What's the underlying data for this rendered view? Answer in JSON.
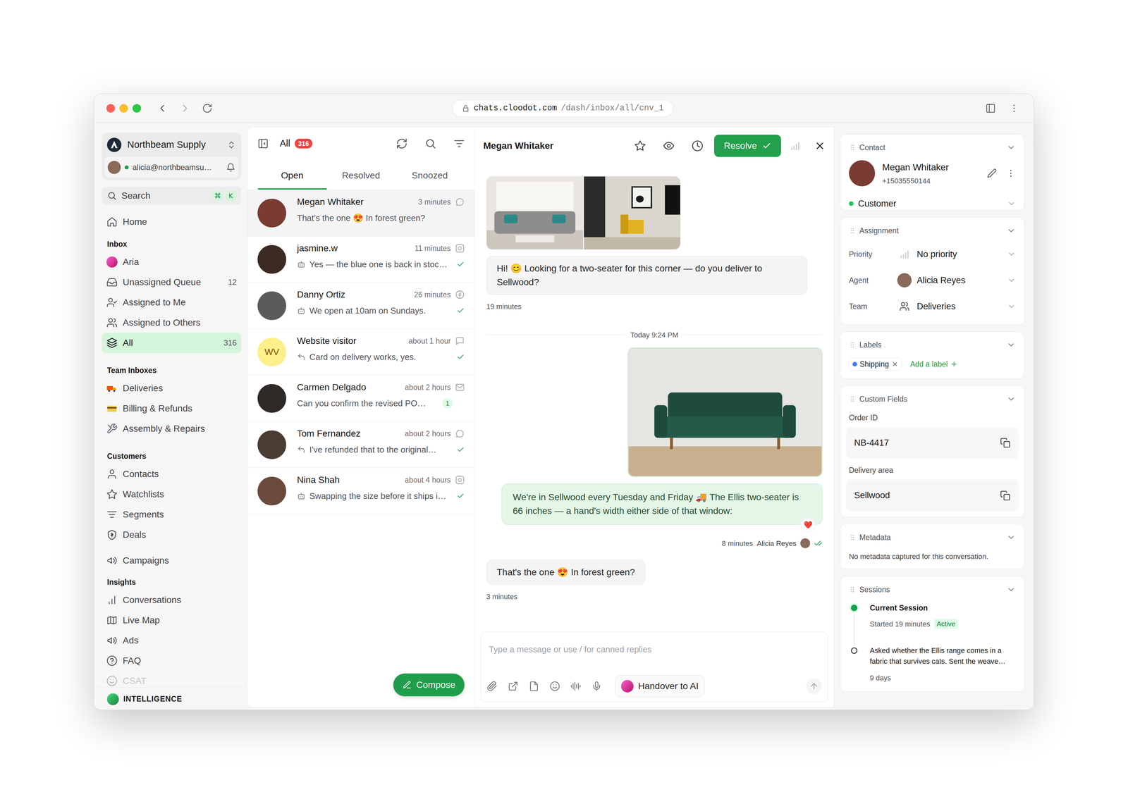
{
  "browser": {
    "host": "chats.cloodot.com",
    "path": "/dash/inbox/all/cnv_1"
  },
  "workspace": {
    "name": "Northbeam Supply",
    "email": "alicia@northbeamsu…",
    "online": true
  },
  "search": {
    "label": "Search",
    "keys": [
      "⌘",
      "K"
    ]
  },
  "nav": {
    "home": {
      "label": "Home",
      "selected": false
    },
    "sections": [
      {
        "title": "Inbox",
        "items": [
          {
            "label": "Aria",
            "kind": "avatar",
            "selected": false
          },
          {
            "label": "Unassigned Queue",
            "kind": "icon",
            "count": "12",
            "selected": false
          },
          {
            "label": "Assigned to Me",
            "kind": "icon",
            "selected": false
          },
          {
            "label": "Assigned to Others",
            "kind": "icon",
            "selected": false
          },
          {
            "label": "All",
            "kind": "icon",
            "count": "316",
            "selected": true
          }
        ]
      },
      {
        "title": "Team Inboxes",
        "items": [
          {
            "label": "Deliveries",
            "selected": false
          },
          {
            "label": "Billing & Refunds",
            "selected": false
          },
          {
            "label": "Assembly & Repairs",
            "selected": false
          }
        ]
      },
      {
        "title": "Customers",
        "items": [
          {
            "label": "Contacts",
            "selected": false
          },
          {
            "label": "Watchlists",
            "selected": false
          },
          {
            "label": "Segments",
            "selected": false
          },
          {
            "label": "Deals",
            "selected": false
          }
        ]
      },
      {
        "title": "Insights",
        "items": [
          {
            "label": "Conversations",
            "selected": false,
            "faded": false
          },
          {
            "label": "Live Map",
            "selected": false,
            "faded": false
          },
          {
            "label": "Ads",
            "selected": false,
            "faded": false
          },
          {
            "label": "FAQ",
            "selected": false,
            "faded": false
          },
          {
            "label": "CSAT",
            "selected": false,
            "faded": true
          }
        ]
      }
    ],
    "campaigns": {
      "label": "Campaigns",
      "selected": false
    }
  },
  "footer": {
    "label": "INTELLIGENCE"
  },
  "list": {
    "title": "All",
    "badge": "316",
    "tabs": [
      {
        "label": "Open",
        "selected": true
      },
      {
        "label": "Resolved",
        "selected": false
      },
      {
        "label": "Snoozed",
        "selected": false
      }
    ],
    "conversations": [
      {
        "name": "Megan Whitaker",
        "time": "3 minutes",
        "preview": "That's the one 😍 In forest green?",
        "channel": "whatsapp",
        "prefix": "none",
        "delivered": false,
        "selected": true
      },
      {
        "name": "jasmine.w",
        "time": "11 minutes",
        "preview": "Yes — the blue one is back in stoc…",
        "channel": "instagram",
        "prefix": "bot",
        "delivered": true,
        "selected": false
      },
      {
        "name": "Danny Ortiz",
        "time": "26 minutes",
        "preview": "We open at 10am on Sundays.",
        "channel": "facebook",
        "prefix": "bot",
        "delivered": true,
        "selected": false
      },
      {
        "name": "Website visitor",
        "initials": "WV",
        "time": "about 1 hour",
        "preview": "Card on delivery works, yes.",
        "channel": "web",
        "prefix": "reply",
        "delivered": true,
        "selected": false
      },
      {
        "name": "Carmen Delgado",
        "time": "about 2 hours",
        "preview": "Can you confirm the revised PO…",
        "channel": "email",
        "prefix": "none",
        "unread": "1",
        "delivered": false,
        "selected": false
      },
      {
        "name": "Tom Fernandez",
        "time": "about 2 hours",
        "preview": "I've refunded that to the original…",
        "channel": "whatsapp",
        "prefix": "reply",
        "delivered": true,
        "selected": false
      },
      {
        "name": "Nina Shah",
        "time": "about 4 hours",
        "preview": "Swapping the size before it ships i…",
        "channel": "instagram",
        "prefix": "bot",
        "delivered": true,
        "selected": false
      }
    ],
    "compose": "Compose"
  },
  "chat": {
    "contact": "Megan Whitaker",
    "starred": false,
    "resolve": "Resolve",
    "priority_level": 0,
    "messages": [
      {
        "kind": "photo",
        "direction": "incoming",
        "images": 2
      },
      {
        "kind": "text",
        "direction": "incoming",
        "text": "Hi! 😊 Looking for a two-seater for this corner — do you deliver to Sellwood?",
        "time": "19 minutes"
      },
      {
        "kind": "divider",
        "text": "Today 9:24 PM"
      },
      {
        "kind": "photo",
        "direction": "outgoing",
        "images": 1
      },
      {
        "kind": "text",
        "direction": "outgoing",
        "text": "We're in Sellwood every Tuesday and Friday 🚚 The Ellis two-seater is 66 inches — a hand's width either side of that window:",
        "reaction": "❤️",
        "time": "8 minutes",
        "agent": "Alicia Reyes",
        "read": true
      },
      {
        "kind": "text",
        "direction": "incoming",
        "text": "That's the one 😍 In forest green?",
        "time": "3 minutes"
      }
    ],
    "composer": {
      "placeholder": "Type a message or use / for canned replies",
      "handover": "Handover to AI"
    }
  },
  "details": {
    "contact": {
      "title": "Contact",
      "name": "Megan Whitaker",
      "phone": "+15035550144",
      "status": "Customer",
      "status_color": "#22c55e"
    },
    "assignment": {
      "title": "Assignment",
      "rows": [
        {
          "label": "Priority",
          "value": "No priority",
          "kind": "priority",
          "level": 0
        },
        {
          "label": "Agent",
          "value": "Alicia Reyes",
          "kind": "agent"
        },
        {
          "label": "Team",
          "value": "Deliveries",
          "kind": "team"
        }
      ]
    },
    "labels": {
      "title": "Labels",
      "items": [
        {
          "label": "Shipping",
          "color": "#3b82f6"
        }
      ],
      "add": "Add a label"
    },
    "custom_fields": {
      "title": "Custom Fields",
      "fields": [
        {
          "label": "Order ID",
          "value": "NB-4417"
        },
        {
          "label": "Delivery area",
          "value": "Sellwood"
        }
      ]
    },
    "metadata": {
      "title": "Metadata",
      "empty": "No metadata captured for this conversation."
    },
    "sessions": {
      "title": "Sessions",
      "items": [
        {
          "title": "Current Session",
          "detail": "Started 19 minutes",
          "badge": "Active",
          "active": true
        },
        {
          "summary": "Asked whether the Ellis range comes in a fabric that survives cats. Sent the weave…",
          "age": "9 days",
          "active": false
        }
      ]
    }
  }
}
